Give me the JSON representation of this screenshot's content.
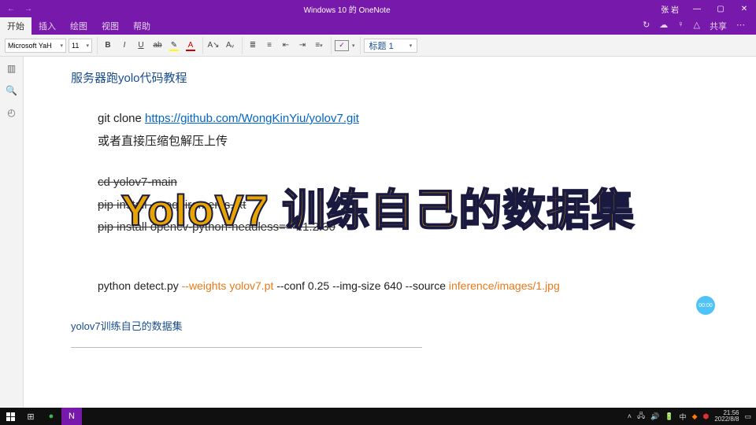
{
  "window": {
    "title": "Windows 10 的 OneNote",
    "user": "张 岩"
  },
  "menu": {
    "tabs": [
      "开始",
      "插入",
      "绘图",
      "视图",
      "帮助"
    ],
    "share": "共享"
  },
  "ribbon": {
    "font_name": "Microsoft YaH",
    "font_size": "11",
    "style_label": "标题 1"
  },
  "note": {
    "title": "服务器跑yolo代码教程",
    "clone_prefix": "git clone ",
    "clone_url": "https://github.com/WongKinYiu/yolov7.git",
    "alt_upload": "或者直接压缩包解压上传",
    "cmd1": "cd yolov7-main",
    "cmd2": "pip install -r requirements.txt",
    "cmd3": "pip install opencv-python-headless==4.1.2.30",
    "detect_a": "python detect.py ",
    "detect_b": "--weights yolov7.pt",
    "detect_c": " --conf 0.25 --img-size 640 --source ",
    "detect_d": "inference/images/1.jpg",
    "subhead": "yolov7训练自己的数据集"
  },
  "overlay": "YoloV7 训练自己的数据集",
  "bubble": "00:00",
  "taskbar": {
    "time": "21:56",
    "date": "2022/8/8",
    "ime": "中"
  }
}
